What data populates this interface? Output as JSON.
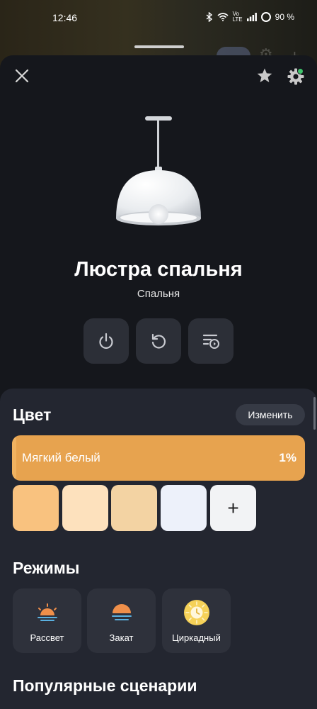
{
  "status_bar": {
    "time": "12:46",
    "battery": "90 %"
  },
  "device": {
    "name": "Люстра спальня",
    "room": "Спальня"
  },
  "controls": [
    {
      "icon": "power-icon"
    },
    {
      "icon": "refresh-icon"
    },
    {
      "icon": "schedule-icon"
    }
  ],
  "color_section": {
    "title": "Цвет",
    "change_label": "Изменить",
    "current": "Мягкий белый",
    "brightness": "1%",
    "brightness_value": 0.01,
    "accent": "#e7a34f",
    "swatches": [
      "#f9c27f",
      "#fde1bd",
      "#f3d3a3",
      "#edf1fa"
    ],
    "add_label": "+"
  },
  "modes_section": {
    "title": "Режимы",
    "items": [
      {
        "label": "Рассвет",
        "icon": "sunrise-icon"
      },
      {
        "label": "Закат",
        "icon": "sunset-icon"
      },
      {
        "label": "Циркадный",
        "icon": "circadian-icon"
      }
    ]
  },
  "scenarios_section": {
    "title": "Популярные сценарии"
  }
}
